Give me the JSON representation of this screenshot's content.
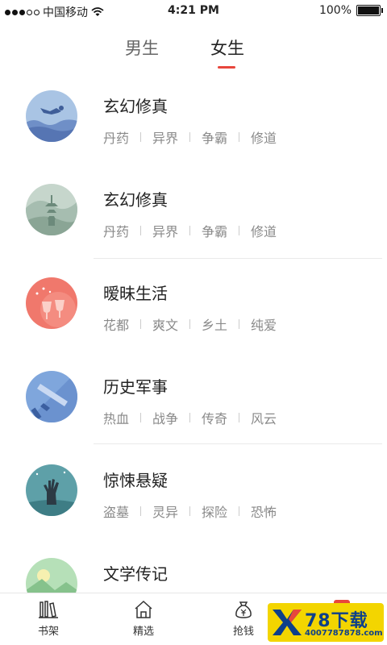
{
  "status_bar": {
    "carrier": "中国移动",
    "time": "4:21 PM",
    "battery": "100%"
  },
  "tabs": [
    {
      "label": "男生"
    },
    {
      "label": "女生",
      "active": true
    }
  ],
  "categories": [
    {
      "title": "玄幻修真",
      "tags": [
        "丹药",
        "异界",
        "争霸",
        "修道"
      ],
      "icon": "diver-icon"
    },
    {
      "title": "玄幻修真",
      "tags": [
        "丹药",
        "异界",
        "争霸",
        "修道"
      ],
      "icon": "pagoda-icon"
    },
    {
      "title": "暧昧生活",
      "tags": [
        "花都",
        "爽文",
        "乡土",
        "纯爱"
      ],
      "icon": "wine-glasses-icon"
    },
    {
      "title": "历史军事",
      "tags": [
        "热血",
        "战争",
        "传奇",
        "风云"
      ],
      "icon": "sword-icon"
    },
    {
      "title": "惊悚悬疑",
      "tags": [
        "盗墓",
        "灵异",
        "探险",
        "恐怖"
      ],
      "icon": "zombie-hand-icon"
    },
    {
      "title": "文学传记",
      "tags": [],
      "icon": "landscape-icon"
    }
  ],
  "tabbar": [
    {
      "label": "书架",
      "icon": "bookshelf-icon"
    },
    {
      "label": "精选",
      "icon": "home-icon"
    },
    {
      "label": "抢钱",
      "icon": "money-bag-icon"
    }
  ],
  "watermark": {
    "text": "78下载",
    "sub": "4007787878.com"
  },
  "colors": {
    "accent": "#e8463c"
  }
}
